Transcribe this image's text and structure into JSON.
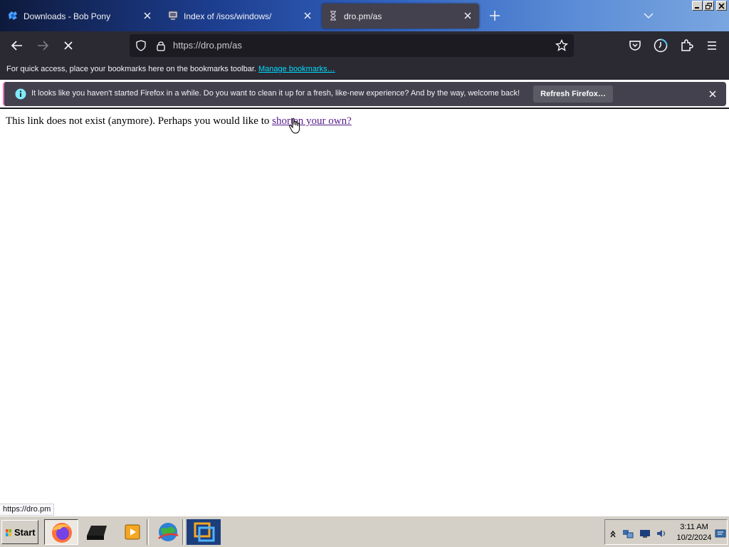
{
  "browser": {
    "tabs": [
      {
        "title": "Downloads - Bob Pony",
        "icon": "puzzle-icon"
      },
      {
        "title": "Index of /isos/windows/",
        "icon": "server-icon"
      },
      {
        "title": "dro.pm/as",
        "icon": "hourglass-icon",
        "active": true
      }
    ],
    "url": "https://dro.pm/as",
    "bookmarks_message": "For quick access, place your bookmarks here on the bookmarks toolbar.",
    "bookmarks_link": "Manage bookmarks…",
    "notification": {
      "message": "It looks like you haven't started Firefox in a while. Do you want to clean it up for a fresh, like-new experience? And by the way, welcome back!",
      "button": "Refresh Firefox…"
    },
    "status_url": "https://dro.pm"
  },
  "page": {
    "text_before": "This link does not exist (anymore). Perhaps you would like to ",
    "link_text": "shorten your own?"
  },
  "taskbar": {
    "start_label": "Start",
    "clock_time": "3:11 AM",
    "clock_date": "10/2/2024"
  },
  "colors": {
    "tab_active": "#42414d",
    "toolbar": "#2b2a33",
    "link_cyan": "#00ddff",
    "visited_link": "#551a8b",
    "notice_accent": "#ff6bba"
  }
}
